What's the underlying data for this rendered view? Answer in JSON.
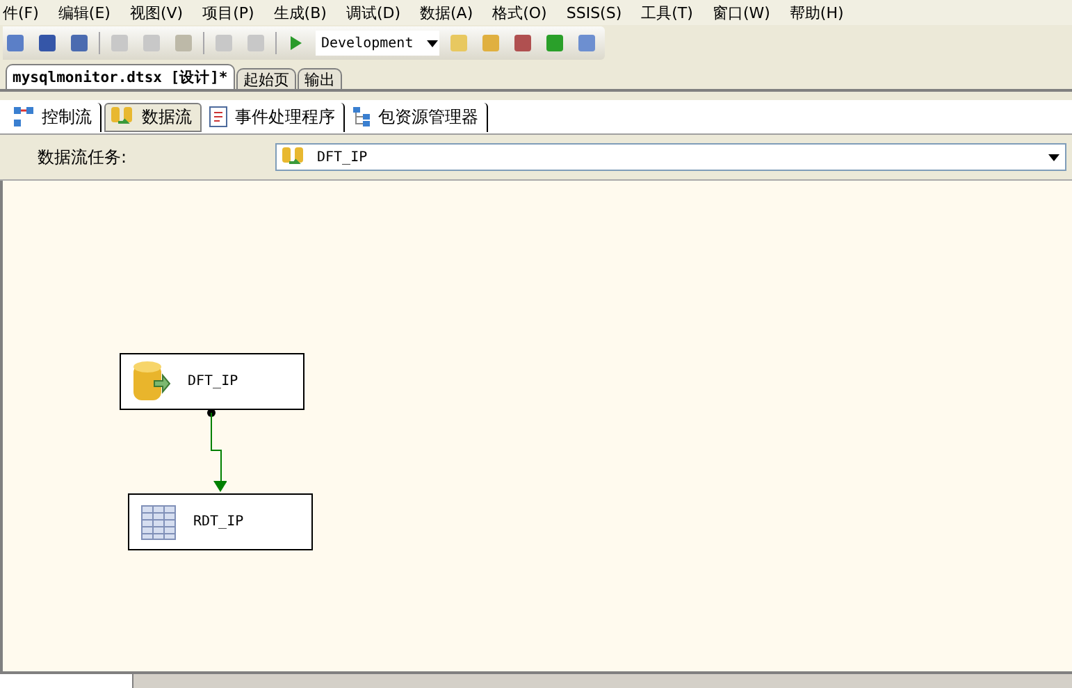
{
  "menu": [
    "件(F)",
    "编辑(E)",
    "视图(V)",
    "项目(P)",
    "生成(B)",
    "调试(D)",
    "数据(A)",
    "格式(O)",
    "SSIS(S)",
    "工具(T)",
    "窗口(W)",
    "帮助(H)"
  ],
  "toolbar": {
    "configuration": "Development"
  },
  "document_tabs": [
    {
      "label": "mysqlmonitor.dtsx [设计]*",
      "selected": true
    },
    {
      "label": "起始页",
      "selected": false
    },
    {
      "label": "输出",
      "selected": false
    }
  ],
  "designer_tabs": [
    {
      "label": "控制流",
      "kind": "control",
      "selected": false
    },
    {
      "label": "数据流",
      "kind": "dataflow",
      "selected": true
    },
    {
      "label": "事件处理程序",
      "kind": "event",
      "selected": false
    },
    {
      "label": "包资源管理器",
      "kind": "explorer",
      "selected": false
    }
  ],
  "task": {
    "label": "数据流任务:",
    "value": "DFT_IP"
  },
  "nodes": [
    {
      "label": "DFT_IP",
      "kind": "source"
    },
    {
      "label": "RDT_IP",
      "kind": "table"
    }
  ]
}
